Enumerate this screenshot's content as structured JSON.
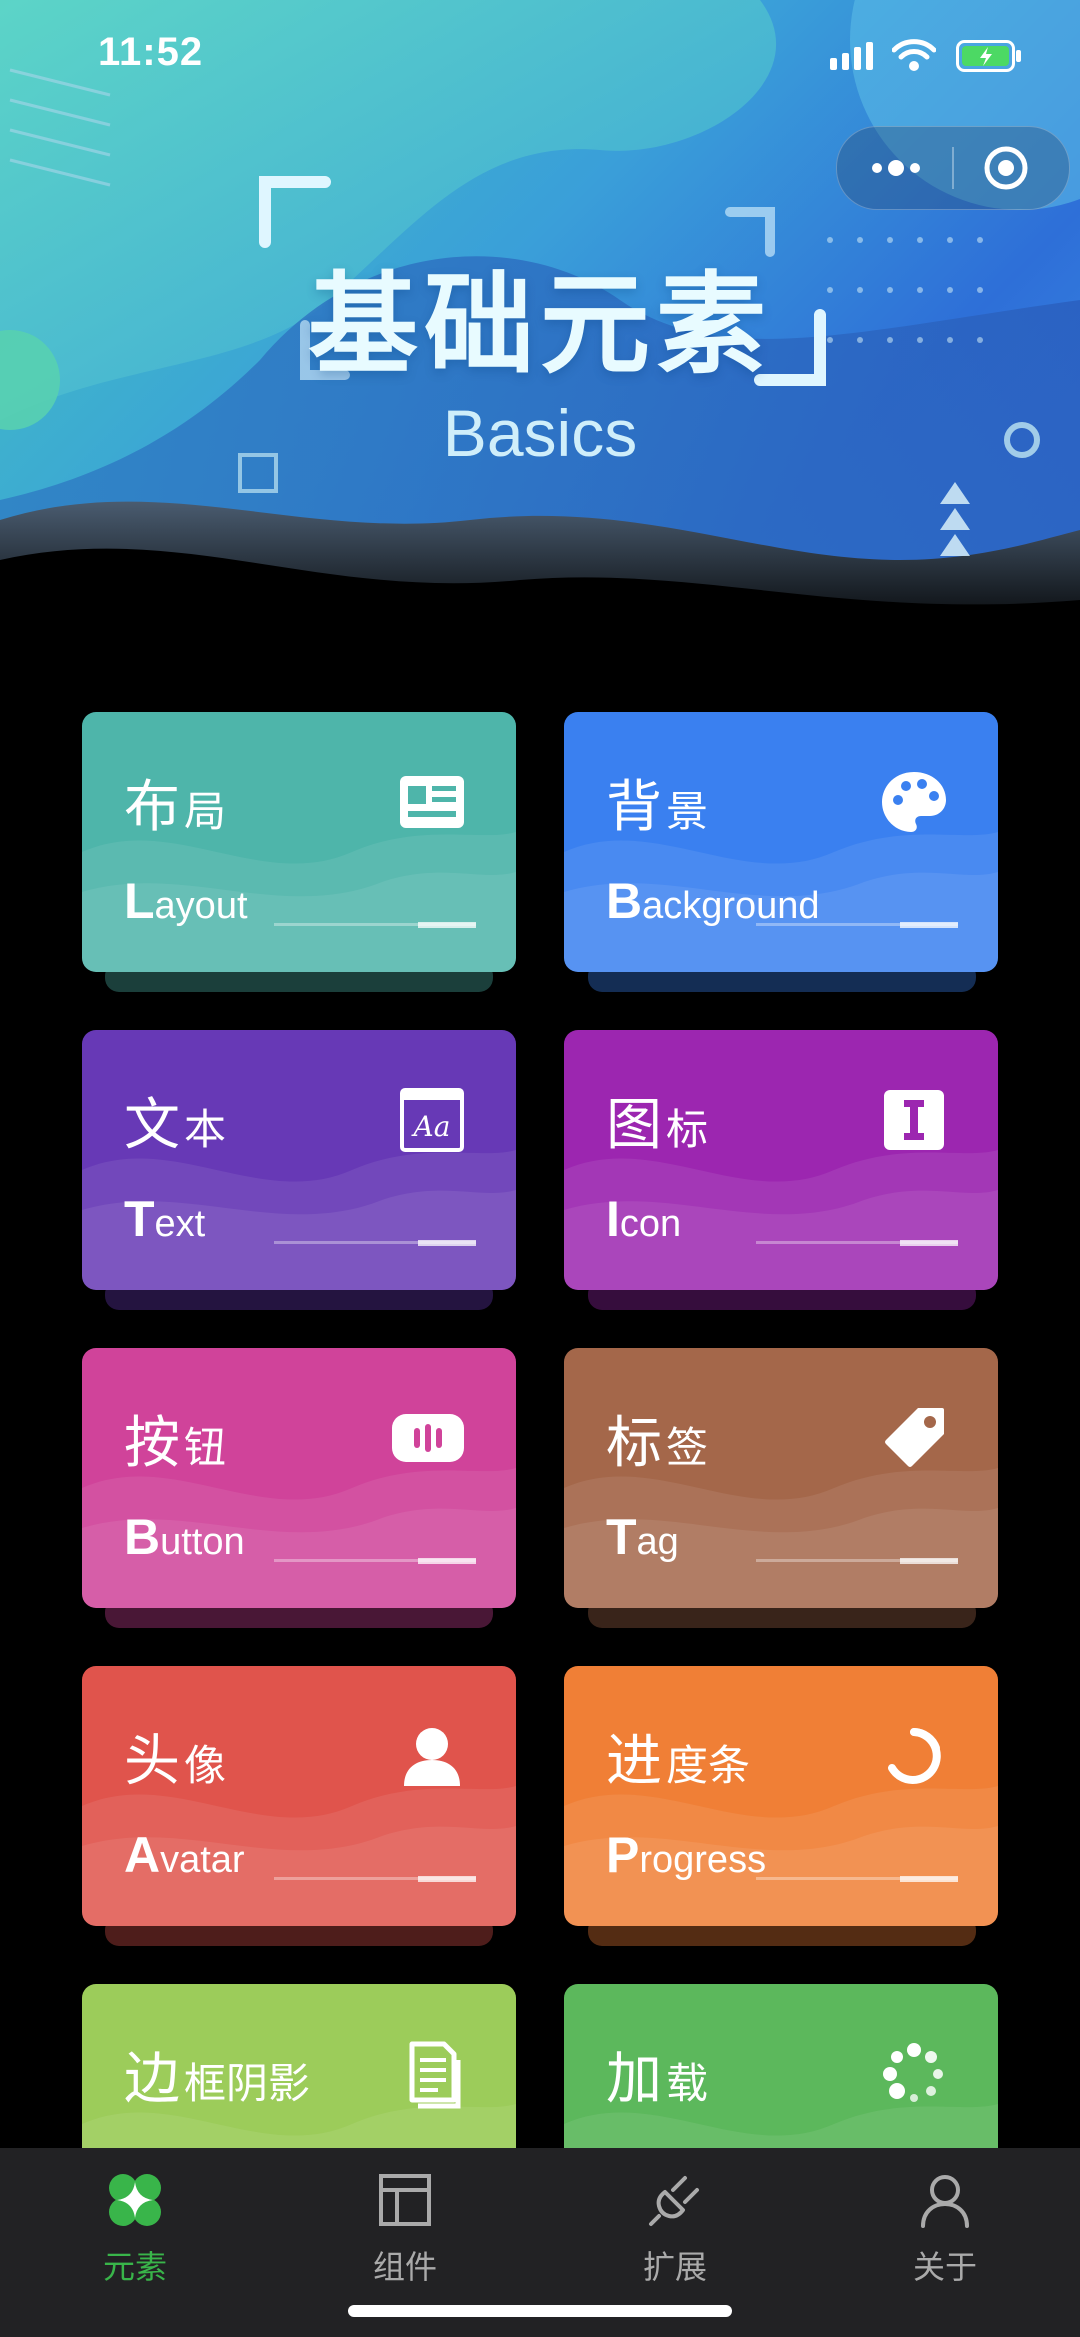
{
  "status_bar": {
    "time": "11:52"
  },
  "header": {
    "title": "基础元素",
    "subtitle": "Basics"
  },
  "colors": {
    "accent": "#39b54a",
    "tab_inactive": "#aaaaaa",
    "tabbar_bg": "#222224"
  },
  "cards": [
    {
      "cn_big": "布",
      "cn_small": "局",
      "en_big": "L",
      "en_small": "ayout",
      "icon": "newspaper-icon",
      "color": "#4eb5aa"
    },
    {
      "cn_big": "背",
      "cn_small": "景",
      "en_big": "B",
      "en_small": "ackground",
      "icon": "palette-icon",
      "color": "#3a80f0"
    },
    {
      "cn_big": "文",
      "cn_small": "本",
      "en_big": "T",
      "en_small": "ext",
      "icon": "text-icon",
      "color": "#6739b6"
    },
    {
      "cn_big": "图",
      "cn_small": "标",
      "en_big": "I",
      "en_small": "con",
      "icon": "icon-icon",
      "color": "#9c26b0"
    },
    {
      "cn_big": "按",
      "cn_small": "钮",
      "en_big": "B",
      "en_small": "utton",
      "icon": "button-icon",
      "color": "#d0439a"
    },
    {
      "cn_big": "标",
      "cn_small": "签",
      "en_big": "T",
      "en_small": "ag",
      "icon": "tag-icon",
      "color": "#a4674a"
    },
    {
      "cn_big": "头",
      "cn_small": "像",
      "en_big": "A",
      "en_small": "vatar",
      "icon": "avatar-icon",
      "color": "#e0544c"
    },
    {
      "cn_big": "进",
      "cn_small": "度条",
      "en_big": "P",
      "en_small": "rogress",
      "icon": "progress-icon",
      "color": "#f07f36"
    },
    {
      "cn_big": "边",
      "cn_small": "框阴影",
      "en_big": "",
      "en_small": "",
      "icon": "document-icon",
      "color": "#9ccc5a"
    },
    {
      "cn_big": "加",
      "cn_small": "载",
      "en_big": "",
      "en_small": "",
      "icon": "loading-icon",
      "color": "#5cb85c"
    }
  ],
  "tabbar": [
    {
      "label": "元素",
      "icon": "clover-icon",
      "active": true
    },
    {
      "label": "组件",
      "icon": "layout-icon",
      "active": false
    },
    {
      "label": "扩展",
      "icon": "plug-icon",
      "active": false
    },
    {
      "label": "关于",
      "icon": "user-icon",
      "active": false
    }
  ]
}
